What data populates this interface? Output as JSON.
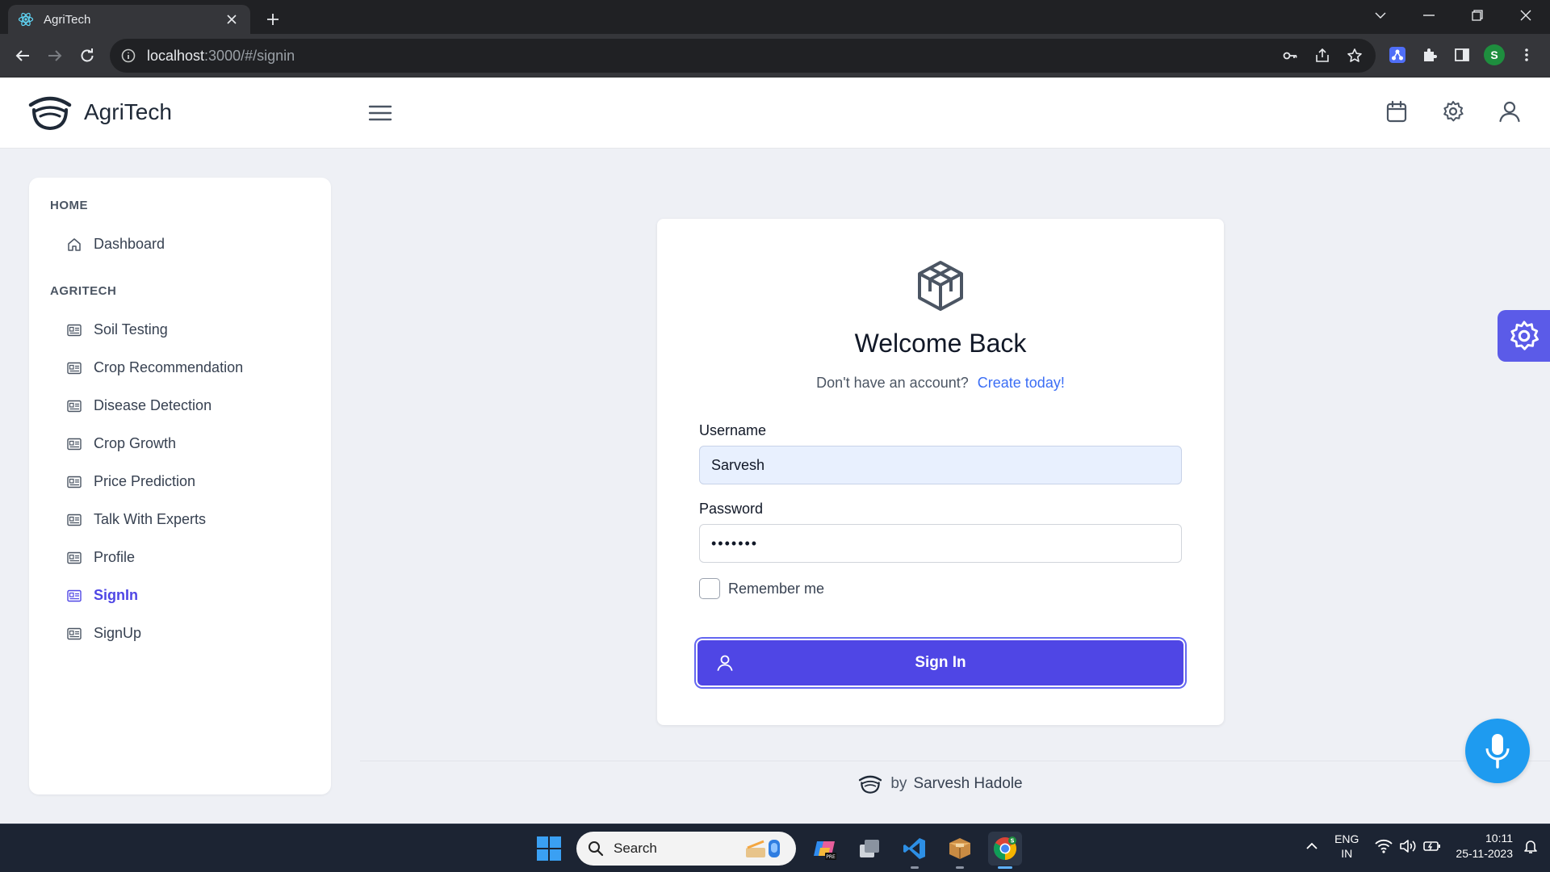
{
  "browser": {
    "tab_title": "AgriTech",
    "url_host": "localhost",
    "url_rest": ":3000/#/signin",
    "profile_initial": "S"
  },
  "app": {
    "brand": "AgriTech",
    "accent_color": "#4f46e5"
  },
  "sidebar": {
    "sections": [
      {
        "title": "HOME",
        "items": [
          {
            "label": "Dashboard",
            "icon": "home-icon"
          }
        ]
      },
      {
        "title": "AGRITECH",
        "items": [
          {
            "label": "Soil Testing",
            "icon": "id-card-icon"
          },
          {
            "label": "Crop Recommendation",
            "icon": "id-card-icon"
          },
          {
            "label": "Disease Detection",
            "icon": "id-card-icon"
          },
          {
            "label": "Crop Growth",
            "icon": "id-card-icon"
          },
          {
            "label": "Price Prediction",
            "icon": "id-card-icon"
          },
          {
            "label": "Talk With Experts",
            "icon": "id-card-icon"
          },
          {
            "label": "Profile",
            "icon": "id-card-icon"
          },
          {
            "label": "SignIn",
            "icon": "id-card-icon",
            "active": true
          },
          {
            "label": "SignUp",
            "icon": "id-card-icon"
          }
        ]
      }
    ]
  },
  "signin": {
    "title": "Welcome Back",
    "subtitle": "Don't have an account?",
    "create_link": "Create today!",
    "username_label": "Username",
    "username_value": "Sarvesh",
    "password_label": "Password",
    "password_value": "•••••••",
    "remember_label": "Remember me",
    "button_label": "Sign In"
  },
  "footer": {
    "by": "by",
    "author": "Sarvesh Hadole"
  },
  "taskbar": {
    "search_placeholder": "Search",
    "lang_top": "ENG",
    "lang_bottom": "IN",
    "time": "10:11",
    "date": "25-11-2023"
  }
}
